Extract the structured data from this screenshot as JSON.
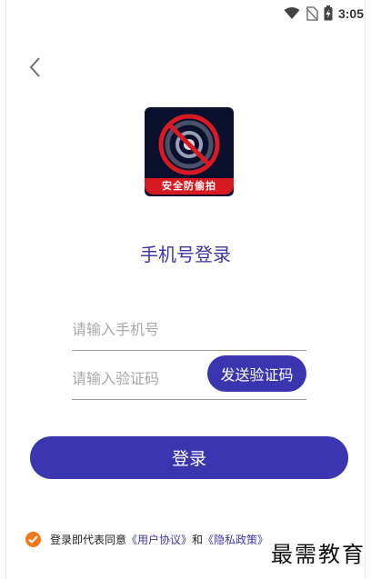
{
  "status_bar": {
    "time": "3:05"
  },
  "logo": {
    "banner_text": "安全防偷拍"
  },
  "page_title": "手机号登录",
  "phone_field": {
    "placeholder": "请输入手机号"
  },
  "code_field": {
    "placeholder": "请输入验证码"
  },
  "send_code_label": "发送验证码",
  "login_label": "登录",
  "agreement": {
    "prefix": "登录即代表同意",
    "user_agreement": "《用户协议》",
    "conjunction": "和",
    "privacy_policy": "《隐私政策》"
  },
  "watermark": "最需教育",
  "colors": {
    "primary": "#3b36b0",
    "check": "#f07a1a",
    "logo_bg": "#0b0f2e",
    "logo_banner": "#d71921"
  }
}
